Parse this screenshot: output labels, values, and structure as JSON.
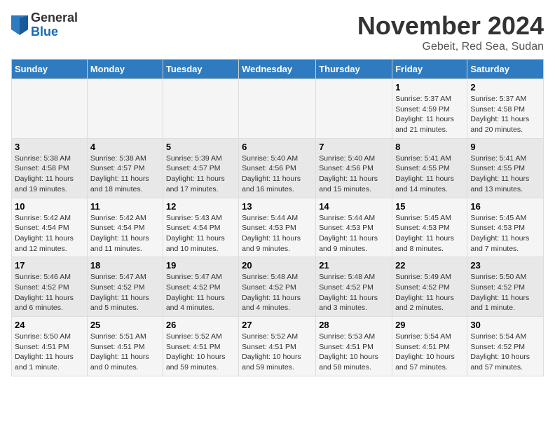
{
  "logo": {
    "general": "General",
    "blue": "Blue"
  },
  "title": {
    "month_year": "November 2024",
    "location": "Gebeit, Red Sea, Sudan"
  },
  "headers": [
    "Sunday",
    "Monday",
    "Tuesday",
    "Wednesday",
    "Thursday",
    "Friday",
    "Saturday"
  ],
  "weeks": [
    [
      {
        "num": "",
        "info": ""
      },
      {
        "num": "",
        "info": ""
      },
      {
        "num": "",
        "info": ""
      },
      {
        "num": "",
        "info": ""
      },
      {
        "num": "",
        "info": ""
      },
      {
        "num": "1",
        "info": "Sunrise: 5:37 AM\nSunset: 4:59 PM\nDaylight: 11 hours and 21 minutes."
      },
      {
        "num": "2",
        "info": "Sunrise: 5:37 AM\nSunset: 4:58 PM\nDaylight: 11 hours and 20 minutes."
      }
    ],
    [
      {
        "num": "3",
        "info": "Sunrise: 5:38 AM\nSunset: 4:58 PM\nDaylight: 11 hours and 19 minutes."
      },
      {
        "num": "4",
        "info": "Sunrise: 5:38 AM\nSunset: 4:57 PM\nDaylight: 11 hours and 18 minutes."
      },
      {
        "num": "5",
        "info": "Sunrise: 5:39 AM\nSunset: 4:57 PM\nDaylight: 11 hours and 17 minutes."
      },
      {
        "num": "6",
        "info": "Sunrise: 5:40 AM\nSunset: 4:56 PM\nDaylight: 11 hours and 16 minutes."
      },
      {
        "num": "7",
        "info": "Sunrise: 5:40 AM\nSunset: 4:56 PM\nDaylight: 11 hours and 15 minutes."
      },
      {
        "num": "8",
        "info": "Sunrise: 5:41 AM\nSunset: 4:55 PM\nDaylight: 11 hours and 14 minutes."
      },
      {
        "num": "9",
        "info": "Sunrise: 5:41 AM\nSunset: 4:55 PM\nDaylight: 11 hours and 13 minutes."
      }
    ],
    [
      {
        "num": "10",
        "info": "Sunrise: 5:42 AM\nSunset: 4:54 PM\nDaylight: 11 hours and 12 minutes."
      },
      {
        "num": "11",
        "info": "Sunrise: 5:42 AM\nSunset: 4:54 PM\nDaylight: 11 hours and 11 minutes."
      },
      {
        "num": "12",
        "info": "Sunrise: 5:43 AM\nSunset: 4:54 PM\nDaylight: 11 hours and 10 minutes."
      },
      {
        "num": "13",
        "info": "Sunrise: 5:44 AM\nSunset: 4:53 PM\nDaylight: 11 hours and 9 minutes."
      },
      {
        "num": "14",
        "info": "Sunrise: 5:44 AM\nSunset: 4:53 PM\nDaylight: 11 hours and 9 minutes."
      },
      {
        "num": "15",
        "info": "Sunrise: 5:45 AM\nSunset: 4:53 PM\nDaylight: 11 hours and 8 minutes."
      },
      {
        "num": "16",
        "info": "Sunrise: 5:45 AM\nSunset: 4:53 PM\nDaylight: 11 hours and 7 minutes."
      }
    ],
    [
      {
        "num": "17",
        "info": "Sunrise: 5:46 AM\nSunset: 4:52 PM\nDaylight: 11 hours and 6 minutes."
      },
      {
        "num": "18",
        "info": "Sunrise: 5:47 AM\nSunset: 4:52 PM\nDaylight: 11 hours and 5 minutes."
      },
      {
        "num": "19",
        "info": "Sunrise: 5:47 AM\nSunset: 4:52 PM\nDaylight: 11 hours and 4 minutes."
      },
      {
        "num": "20",
        "info": "Sunrise: 5:48 AM\nSunset: 4:52 PM\nDaylight: 11 hours and 4 minutes."
      },
      {
        "num": "21",
        "info": "Sunrise: 5:48 AM\nSunset: 4:52 PM\nDaylight: 11 hours and 3 minutes."
      },
      {
        "num": "22",
        "info": "Sunrise: 5:49 AM\nSunset: 4:52 PM\nDaylight: 11 hours and 2 minutes."
      },
      {
        "num": "23",
        "info": "Sunrise: 5:50 AM\nSunset: 4:52 PM\nDaylight: 11 hours and 1 minute."
      }
    ],
    [
      {
        "num": "24",
        "info": "Sunrise: 5:50 AM\nSunset: 4:51 PM\nDaylight: 11 hours and 1 minute."
      },
      {
        "num": "25",
        "info": "Sunrise: 5:51 AM\nSunset: 4:51 PM\nDaylight: 11 hours and 0 minutes."
      },
      {
        "num": "26",
        "info": "Sunrise: 5:52 AM\nSunset: 4:51 PM\nDaylight: 10 hours and 59 minutes."
      },
      {
        "num": "27",
        "info": "Sunrise: 5:52 AM\nSunset: 4:51 PM\nDaylight: 10 hours and 59 minutes."
      },
      {
        "num": "28",
        "info": "Sunrise: 5:53 AM\nSunset: 4:51 PM\nDaylight: 10 hours and 58 minutes."
      },
      {
        "num": "29",
        "info": "Sunrise: 5:54 AM\nSunset: 4:51 PM\nDaylight: 10 hours and 57 minutes."
      },
      {
        "num": "30",
        "info": "Sunrise: 5:54 AM\nSunset: 4:52 PM\nDaylight: 10 hours and 57 minutes."
      }
    ]
  ]
}
